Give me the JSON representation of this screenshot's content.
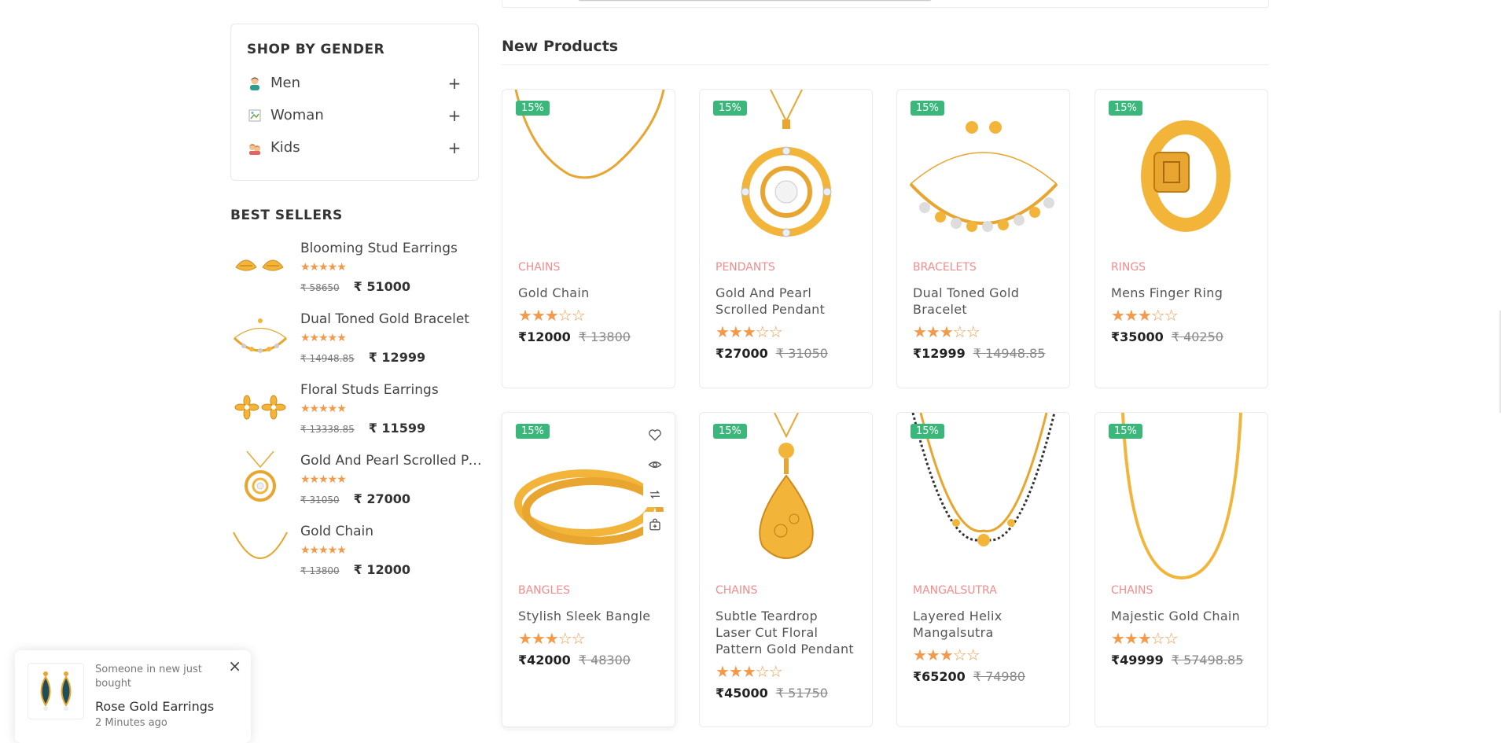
{
  "sidebar": {
    "gender_title": "SHOP BY GENDER",
    "genders": [
      {
        "label": "Men",
        "icon": "man-emoji-icon"
      },
      {
        "label": "Woman",
        "icon": "broken-image-icon"
      },
      {
        "label": "Kids",
        "icon": "kids-emoji-icon"
      }
    ],
    "plus_symbol": "+",
    "best_title": "BEST SELLERS",
    "best_sellers": [
      {
        "name": "Blooming Stud Earrings",
        "stars": "★★★★★",
        "old": "₹ 58650",
        "new": "₹ 51000"
      },
      {
        "name": "Dual Toned Gold Bracelet",
        "stars": "★★★★★",
        "old": "₹ 14948.85",
        "new": "₹ 12999"
      },
      {
        "name": "Floral Studs Earrings",
        "stars": "★★★★★",
        "old": "₹ 13338.85",
        "new": "₹ 11599"
      },
      {
        "name": "Gold And Pearl Scrolled Pendant",
        "stars": "★★★★★",
        "old": "₹ 31050",
        "new": "₹ 27000"
      },
      {
        "name": "Gold Chain",
        "stars": "★★★★★",
        "old": "₹ 13800",
        "new": "₹ 12000"
      }
    ]
  },
  "new_products": {
    "title": "New Products",
    "products": [
      {
        "badge": "15%",
        "category": "CHAINS",
        "title": "Gold Chain",
        "stars": "★★★☆☆",
        "price": "₹12000",
        "old_price": "₹ 13800"
      },
      {
        "badge": "15%",
        "category": "PENDANTS",
        "title": "Gold And Pearl Scrolled Pendant",
        "stars": "★★★☆☆",
        "price": "₹27000",
        "old_price": "₹ 31050"
      },
      {
        "badge": "15%",
        "category": "BRACELETS",
        "title": "Dual Toned Gold Bracelet",
        "stars": "★★★☆☆",
        "price": "₹12999",
        "old_price": "₹ 14948.85"
      },
      {
        "badge": "15%",
        "category": "RINGS",
        "title": "Mens Finger Ring",
        "stars": "★★★☆☆",
        "price": "₹35000",
        "old_price": "₹ 40250"
      },
      {
        "badge": "15%",
        "category": "BANGLES",
        "title": "Stylish Sleek Bangle",
        "stars": "★★★☆☆",
        "price": "₹42000",
        "old_price": "₹ 48300"
      },
      {
        "badge": "15%",
        "category": "CHAINS",
        "title": "Subtle Teardrop Laser Cut Floral Pattern Gold Pendant",
        "stars": "★★★☆☆",
        "price": "₹45000",
        "old_price": "₹ 51750"
      },
      {
        "badge": "15%",
        "category": "MANGALSUTRA",
        "title": "Layered Helix Mangalsutra",
        "stars": "★★★☆☆",
        "price": "₹65200",
        "old_price": "₹ 74980"
      },
      {
        "badge": "15%",
        "category": "CHAINS",
        "title": "Majestic Gold Chain",
        "stars": "★★★☆☆",
        "price": "₹49999",
        "old_price": "₹ 57498.85"
      }
    ]
  },
  "toast": {
    "message": "Someone in new just bought",
    "product": "Rose Gold Earrings",
    "time": "2 Minutes ago",
    "close": "×"
  },
  "colors": {
    "badge": "#3cb77c",
    "category": "#f28c8c",
    "stars": "#f2994a",
    "gold": "#f2b53a"
  }
}
